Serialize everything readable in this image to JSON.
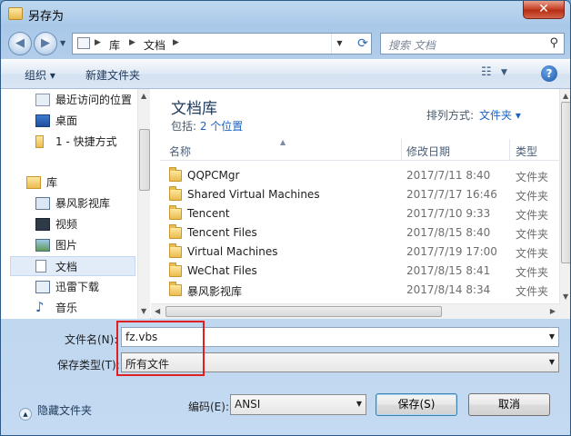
{
  "window": {
    "title": "另存为",
    "close_label": "✕"
  },
  "address": {
    "segments": [
      "库",
      "文档"
    ],
    "search_placeholder": "搜索 文档"
  },
  "toolbar": {
    "organize_label": "组织 ▾",
    "new_folder_label": "新建文件夹",
    "help_label": "?"
  },
  "nav": {
    "items": [
      {
        "label": "最近访问的位置",
        "icon": "recent-places-icon"
      },
      {
        "label": "桌面",
        "icon": "desktop-icon"
      },
      {
        "label": "1 - 快捷方式",
        "icon": "folder-icon"
      },
      {
        "label": "库",
        "icon": "library-icon"
      },
      {
        "label": "暴风影视库",
        "icon": "video-library-icon"
      },
      {
        "label": "视频",
        "icon": "video-icon"
      },
      {
        "label": "图片",
        "icon": "picture-icon"
      },
      {
        "label": "文档",
        "icon": "document-icon",
        "selected": true
      },
      {
        "label": "迅雷下载",
        "icon": "download-icon"
      },
      {
        "label": "音乐",
        "icon": "music-icon"
      }
    ]
  },
  "library": {
    "title": "文档库",
    "includes_prefix": "包括: ",
    "includes_link": "2 个位置",
    "arrange_label": "排列方式:",
    "arrange_value": "文件夹 ▾"
  },
  "columns": {
    "name": "名称",
    "date": "修改日期",
    "type": "类型"
  },
  "files": [
    {
      "name": "QQPCMgr",
      "date": "2017/7/11 8:40",
      "type": "文件夹"
    },
    {
      "name": "Shared Virtual Machines",
      "date": "2017/7/17 16:46",
      "type": "文件夹"
    },
    {
      "name": "Tencent",
      "date": "2017/7/10 9:33",
      "type": "文件夹"
    },
    {
      "name": "Tencent Files",
      "date": "2017/8/15 8:40",
      "type": "文件夹"
    },
    {
      "name": "Virtual Machines",
      "date": "2017/7/19 17:00",
      "type": "文件夹"
    },
    {
      "name": "WeChat Files",
      "date": "2017/8/15 8:41",
      "type": "文件夹"
    },
    {
      "name": "暴风影视库",
      "date": "2017/8/14 8:34",
      "type": "文件夹"
    }
  ],
  "form": {
    "filename_label": "文件名(N):",
    "filename_value": "fz.vbs",
    "filetype_label": "保存类型(T):",
    "filetype_value": "所有文件"
  },
  "bottom": {
    "hide_folders_label": "隐藏文件夹",
    "encoding_label": "编码(E):",
    "encoding_value": "ANSI",
    "save_label": "保存(S)",
    "cancel_label": "取消"
  }
}
